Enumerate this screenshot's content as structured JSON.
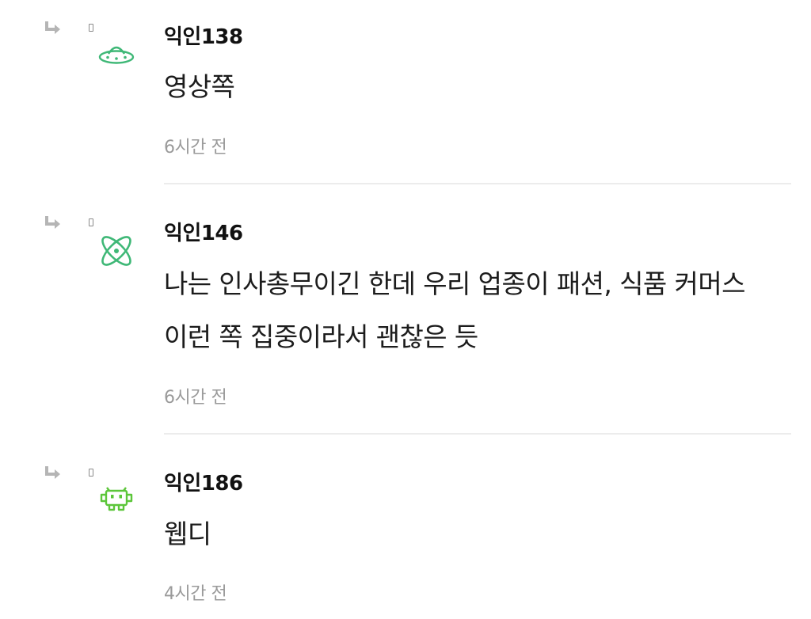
{
  "comments": [
    {
      "author": "익인138",
      "avatar_icon": "ufo-icon",
      "avatar_color": "#3fb877",
      "text": "영상쪽",
      "time": "6시간 전"
    },
    {
      "author": "익인146",
      "avatar_icon": "atom-icon",
      "avatar_color": "#3fb877",
      "text": "나는 인사총무이긴 한데 우리 업종이 패션, 식품 커머스 이런 쪽 집중이라서 괜찮은 듯",
      "time": "6시간 전"
    },
    {
      "author": "익인186",
      "avatar_icon": "space-invader-icon",
      "avatar_color": "#5cc63a",
      "text": "웹디",
      "time": "4시간 전"
    }
  ],
  "reply_icon": "reply-arrow-icon",
  "reply_icon_color": "#b5b5b5",
  "divider_color": "#ececec"
}
